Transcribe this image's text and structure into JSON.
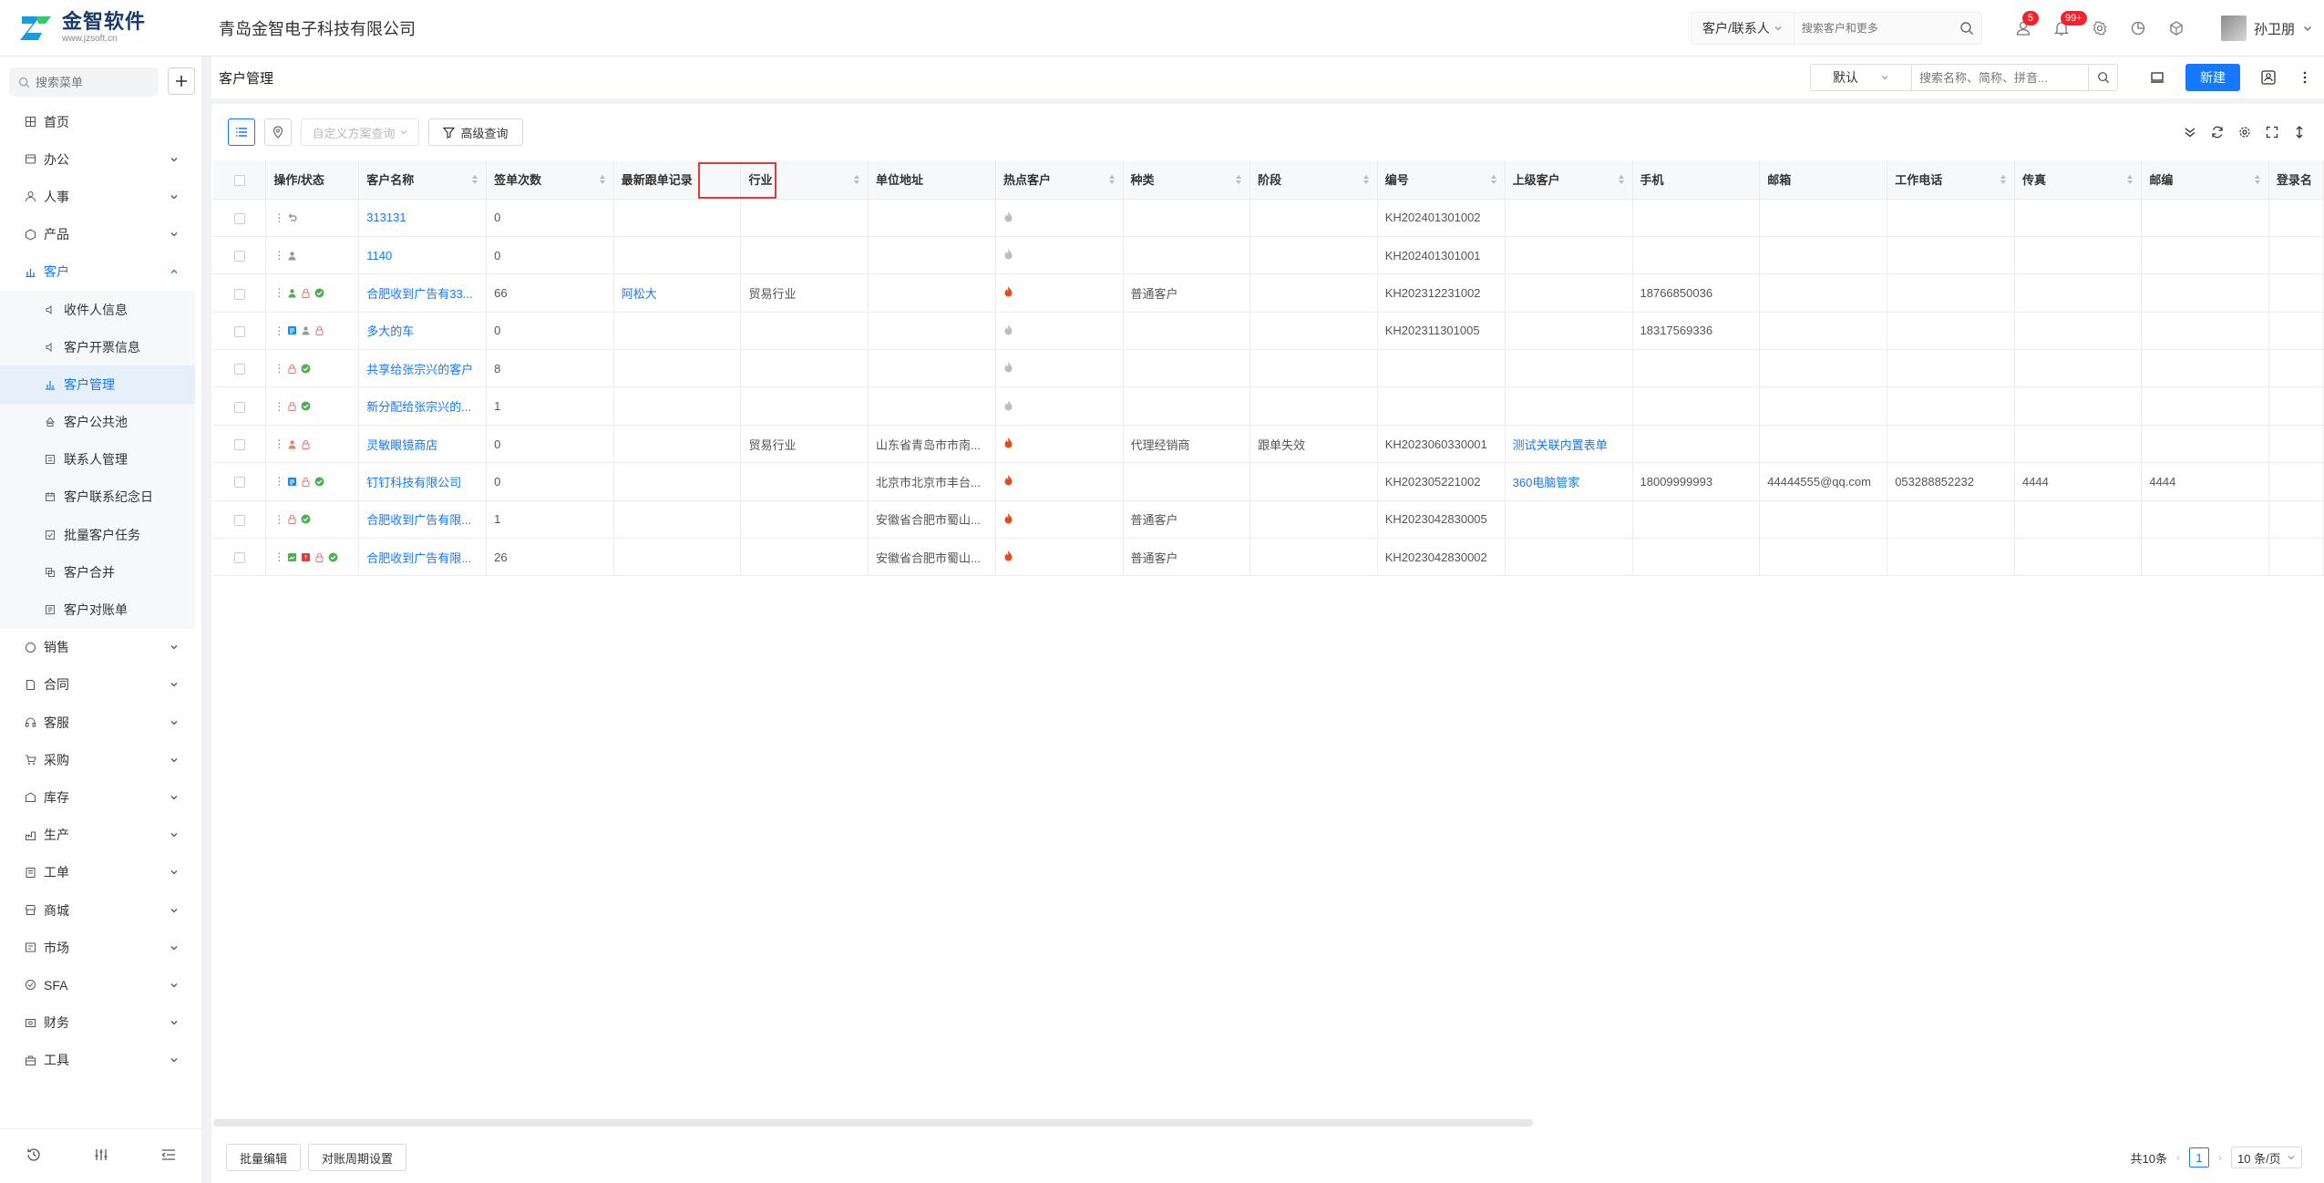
{
  "app": {
    "logo_name": "金智软件",
    "logo_url": "www.jzsoft.cn",
    "company": "青岛金智电子科技有限公司",
    "search_type": "客户/联系人",
    "search_placeholder": "搜索客户和更多",
    "badge_msg": "5",
    "badge_notice": "99+",
    "user_name": "孙卫朋"
  },
  "sidebar": {
    "search_placeholder": "搜索菜单",
    "items_top": [
      {
        "label": "首页",
        "icon": "home-icon"
      },
      {
        "label": "办公",
        "icon": "office-icon"
      },
      {
        "label": "人事",
        "icon": "people-icon"
      },
      {
        "label": "产品",
        "icon": "product-icon"
      },
      {
        "label": "客户",
        "icon": "customer-icon"
      }
    ],
    "submenu": [
      {
        "label": "收件人信息"
      },
      {
        "label": "客户开票信息"
      },
      {
        "label": "客户管理"
      },
      {
        "label": "客户公共池"
      },
      {
        "label": "联系人管理"
      },
      {
        "label": "客户联系纪念日"
      },
      {
        "label": "批量客户任务"
      },
      {
        "label": "客户合并"
      },
      {
        "label": "客户对账单"
      }
    ],
    "items_bottom": [
      {
        "label": "销售"
      },
      {
        "label": "合同"
      },
      {
        "label": "客服"
      },
      {
        "label": "采购"
      },
      {
        "label": "库存"
      },
      {
        "label": "生产"
      },
      {
        "label": "工单"
      },
      {
        "label": "商城"
      },
      {
        "label": "市场"
      },
      {
        "label": "SFA"
      },
      {
        "label": "财务"
      },
      {
        "label": "工具"
      }
    ]
  },
  "header": {
    "title": "客户管理",
    "view": "默认",
    "search_placeholder": "搜索名称、简称、拼音...",
    "new_label": "新建"
  },
  "toolbar": {
    "scheme_placeholder": "自定义方案查询",
    "advanced_label": "高级查询"
  },
  "table": {
    "columns": [
      "操作/状态",
      "客户名称",
      "签单次数",
      "最新跟单记录",
      "行业",
      "单位地址",
      "热点客户",
      "种类",
      "阶段",
      "编号",
      "上级客户",
      "手机",
      "邮箱",
      "工作电话",
      "传真",
      "邮编",
      "登录名"
    ],
    "rows": [
      {
        "name": "313131",
        "count": "0",
        "record": "",
        "industry": "",
        "address": "",
        "hot": false,
        "kind": "",
        "stage": "",
        "code": "KH202401301002",
        "parent": "",
        "mobile": "",
        "email": "",
        "phone": "",
        "fax": "",
        "zip": ""
      },
      {
        "name": "1140",
        "count": "0",
        "record": "",
        "industry": "",
        "address": "",
        "hot": false,
        "kind": "",
        "stage": "",
        "code": "KH202401301001",
        "parent": "",
        "mobile": "",
        "email": "",
        "phone": "",
        "fax": "",
        "zip": ""
      },
      {
        "name": "合肥收到广告有33...",
        "count": "66",
        "record": "阿松大",
        "industry": "贸易行业",
        "address": "",
        "hot": true,
        "kind": "普通客户",
        "stage": "",
        "code": "KH202312231002",
        "parent": "",
        "mobile": "18766850036",
        "email": "",
        "phone": "",
        "fax": "",
        "zip": ""
      },
      {
        "name": "多大的车",
        "count": "0",
        "record": "",
        "industry": "",
        "address": "",
        "hot": false,
        "kind": "",
        "stage": "",
        "code": "KH202311301005",
        "parent": "",
        "mobile": "18317569336",
        "email": "",
        "phone": "",
        "fax": "",
        "zip": ""
      },
      {
        "name": "共享给张宗兴的客户",
        "count": "8",
        "record": "",
        "industry": "",
        "address": "",
        "hot": false,
        "kind": "",
        "stage": "",
        "code": "",
        "parent": "",
        "mobile": "",
        "email": "",
        "phone": "",
        "fax": "",
        "zip": ""
      },
      {
        "name": "新分配给张宗兴的...",
        "count": "1",
        "record": "",
        "industry": "",
        "address": "",
        "hot": false,
        "kind": "",
        "stage": "",
        "code": "",
        "parent": "",
        "mobile": "",
        "email": "",
        "phone": "",
        "fax": "",
        "zip": ""
      },
      {
        "name": "灵敏眼镜商店",
        "count": "0",
        "record": "",
        "industry": "贸易行业",
        "address": "山东省青岛市市南...",
        "hot": true,
        "kind": "代理经销商",
        "stage": "跟单失效",
        "code": "KH2023060330001",
        "parent": "测试关联内置表单",
        "mobile": "",
        "email": "",
        "phone": "",
        "fax": "",
        "zip": ""
      },
      {
        "name": "钉钉科技有限公司",
        "count": "0",
        "record": "",
        "industry": "",
        "address": "北京市北京市丰台...",
        "hot": true,
        "kind": "",
        "stage": "",
        "code": "KH202305221002",
        "parent": "360电脑管家",
        "mobile": "18009999993",
        "email": "44444555@qq.com",
        "phone": "053288852232",
        "fax": "4444",
        "zip": "4444"
      },
      {
        "name": "合肥收到广告有限...",
        "count": "1",
        "record": "",
        "industry": "",
        "address": "安徽省合肥市蜀山...",
        "hot": true,
        "kind": "普通客户",
        "stage": "",
        "code": "KH2023042830005",
        "parent": "",
        "mobile": "",
        "email": "",
        "phone": "",
        "fax": "",
        "zip": ""
      },
      {
        "name": "合肥收到广告有限...",
        "count": "26",
        "record": "",
        "industry": "",
        "address": "安徽省合肥市蜀山...",
        "hot": true,
        "kind": "普通客户",
        "stage": "",
        "code": "KH2023042830002",
        "parent": "",
        "mobile": "",
        "email": "",
        "phone": "",
        "fax": "",
        "zip": ""
      }
    ]
  },
  "footer": {
    "batch_edit": "批量编辑",
    "period_setting": "对账周期设置",
    "total": "共10条",
    "current_page": "1",
    "page_size": "10 条/页"
  },
  "colors": {
    "accent": "#1677ff",
    "highlight_border": "#e53935",
    "hot": "#e64a19",
    "cold": "#bdbdbd"
  }
}
